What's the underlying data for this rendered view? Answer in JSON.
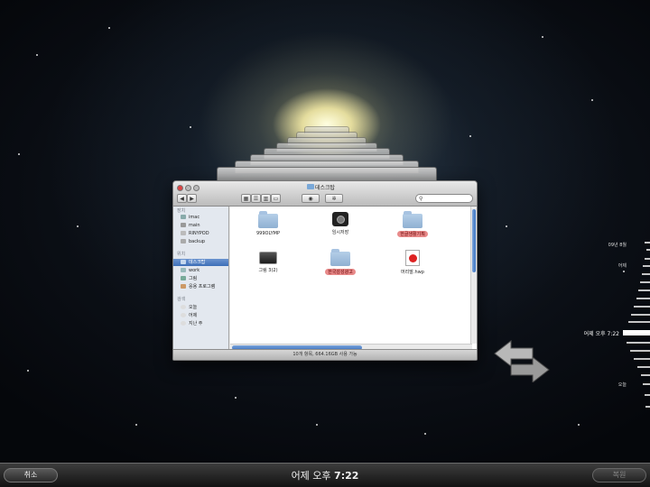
{
  "window": {
    "title": "데스크탑",
    "search_placeholder": ""
  },
  "toolbar": {
    "back_icon": "left-arrow-icon",
    "forward_icon": "right-arrow-icon",
    "eye_icon": "quicklook-eye-icon",
    "gear_icon": "gear-icon",
    "search_icon": "magnifier-icon"
  },
  "sidebar": {
    "sections": [
      {
        "title": "장치",
        "items": [
          "imac",
          "main",
          "RINYPOD",
          "backup"
        ]
      },
      {
        "title": "위치",
        "items": [
          "데스크탑",
          "work",
          "그림",
          "응용 프로그램"
        ]
      },
      {
        "title": "검색",
        "items": [
          "오늘",
          "어제",
          "지난 주"
        ]
      }
    ],
    "selected": "데스크탑"
  },
  "files": [
    {
      "name": "999OLYMP",
      "kind": "folder",
      "label": ""
    },
    {
      "name": "임시저장",
      "kind": "camera",
      "label": ""
    },
    {
      "name": "한글생활기획",
      "kind": "folder",
      "label": "red"
    },
    {
      "name": "그림 3(2)",
      "kind": "app",
      "label": ""
    },
    {
      "name": "한국감성광고",
      "kind": "folder",
      "label": "red"
    },
    {
      "name": "머리말.hwp",
      "kind": "hwp",
      "label": ""
    }
  ],
  "status": "10개 항목, 664.16GB 사용 가능",
  "timeline": {
    "labels": [
      "09년 8월",
      "어제",
      "어제 오후 7:22",
      "오늘"
    ],
    "current": "어제 오후 7:22"
  },
  "bottom": {
    "cancel": "취소",
    "restore": "복원",
    "time_prefix": "어제 오후",
    "time_value": "7:22"
  }
}
